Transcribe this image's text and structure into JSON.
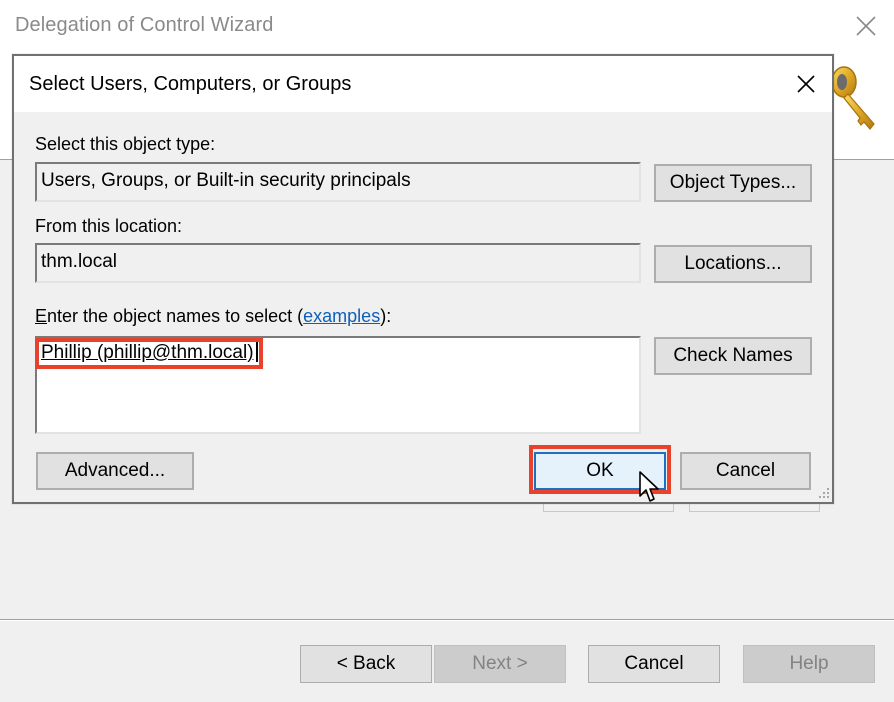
{
  "wizard": {
    "title": "Delegation of Control Wizard",
    "close_icon": "close-icon",
    "header_icon": "key-icon",
    "buttons": {
      "back": "< Back",
      "next": "Next >",
      "cancel": "Cancel",
      "help": "Help"
    },
    "button_states": {
      "back": "enabled",
      "next": "disabled",
      "cancel": "enabled",
      "help": "disabled"
    }
  },
  "dialog": {
    "title": "Select Users, Computers, or Groups",
    "close_icon": "close-icon",
    "object_type": {
      "label": "Select this object type:",
      "value": "Users, Groups, or Built-in security principals",
      "button": "Object Types..."
    },
    "location": {
      "label": "From this location:",
      "value": "thm.local",
      "button": "Locations..."
    },
    "names": {
      "label_accel": "E",
      "label_pre": "nter the object names to select (",
      "label_link": "examples",
      "label_post": "):",
      "value": "Phillip (phillip@thm.local)",
      "button": "Check Names"
    },
    "buttons": {
      "advanced": "Advanced...",
      "ok": "OK",
      "cancel": "Cancel"
    }
  },
  "annotations": {
    "highlight_color": "#e8412c",
    "highlighted": [
      "names-entry",
      "ok-button"
    ]
  },
  "colors": {
    "link": "#0f5fb8",
    "default_button_border": "#1f6fbf",
    "default_button_bg": "#e5f1fb"
  }
}
